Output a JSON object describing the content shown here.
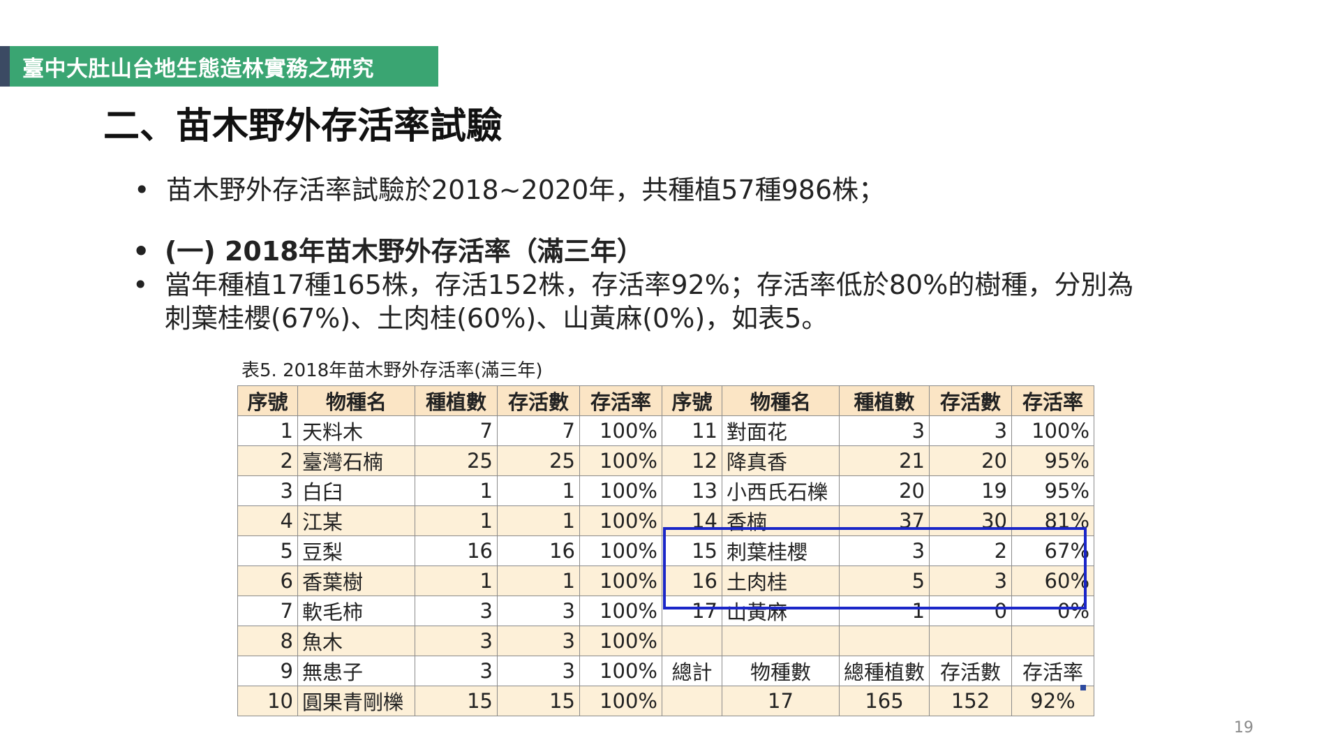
{
  "header": {
    "label": "臺中大肚山台地生態造林實務之研究"
  },
  "title": "二、苗木野外存活率試驗",
  "bullets": {
    "intro": "苗木野外存活率試驗於2018~2020年，共種植57種986株；",
    "section": "(一) 2018年苗木野外存活率（滿三年）",
    "detail_line1": "當年種植17種165株，存活152株，存活率92%；存活率低於80%的樹種，分別為",
    "detail_line2": "刺葉桂櫻(67%)、土肉桂(60%)、山黃麻(0%)，如表5。"
  },
  "table": {
    "caption": "表5. 2018年苗木野外存活率(滿三年)",
    "headers": [
      "序號",
      "物種名",
      "種植數",
      "存活數",
      "存活率",
      "序號",
      "物種名",
      "種植數",
      "存活數",
      "存活率"
    ],
    "rows": [
      [
        "1",
        "天料木",
        "7",
        "7",
        "100%",
        "11",
        "對面花",
        "3",
        "3",
        "100%"
      ],
      [
        "2",
        "臺灣石楠",
        "25",
        "25",
        "100%",
        "12",
        "降真香",
        "21",
        "20",
        "95%"
      ],
      [
        "3",
        "白臼",
        "1",
        "1",
        "100%",
        "13",
        "小西氏石櫟",
        "20",
        "19",
        "95%"
      ],
      [
        "4",
        "江某",
        "1",
        "1",
        "100%",
        "14",
        "香楠",
        "37",
        "30",
        "81%"
      ],
      [
        "5",
        "豆梨",
        "16",
        "16",
        "100%",
        "15",
        "刺葉桂櫻",
        "3",
        "2",
        "67%"
      ],
      [
        "6",
        "香葉樹",
        "1",
        "1",
        "100%",
        "16",
        "土肉桂",
        "5",
        "3",
        "60%"
      ],
      [
        "7",
        "軟毛柿",
        "3",
        "3",
        "100%",
        "17",
        "山黃麻",
        "1",
        "0",
        "0%"
      ],
      [
        "8",
        "魚木",
        "3",
        "3",
        "100%",
        "",
        "",
        "",
        "",
        ""
      ],
      [
        "9",
        "無患子",
        "3",
        "3",
        "100%",
        "總計",
        "物種數",
        "總種植數",
        "存活數",
        "存活率"
      ],
      [
        "10",
        "圓果青剛櫟",
        "15",
        "15",
        "100%",
        "",
        "17",
        "165",
        "152",
        "92%"
      ]
    ]
  },
  "page_number": "19",
  "colors": {
    "header_green": "#3aa572",
    "header_accent": "#3b4a63",
    "table_header_bg": "#fbe5c5",
    "table_stripe_bg": "#fdf0d8",
    "highlight_border": "#1a26c8"
  }
}
